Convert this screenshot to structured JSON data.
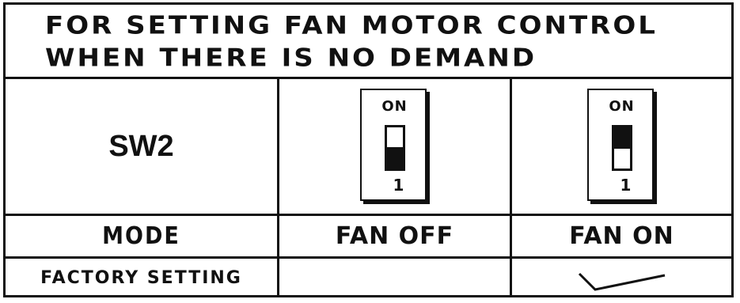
{
  "title": {
    "line1": "FOR SETTING FAN MOTOR CONTROL",
    "line2": "WHEN THERE IS NO DEMAND"
  },
  "table": {
    "switch_label": "SW2",
    "dip_switch_text": {
      "on_label": "ON",
      "position_number": "1"
    },
    "columns": [
      {
        "switch_state": "down",
        "mode": "FAN OFF",
        "factory_setting": false
      },
      {
        "switch_state": "up",
        "mode": "FAN ON",
        "factory_setting": true
      }
    ],
    "mode_label": "MODE",
    "factory_setting_label": "FACTORY SETTING"
  },
  "icons": {
    "factory_check": "checkmark-icon",
    "dip_switch": "dip-switch-icon"
  },
  "colors": {
    "ink": "#111111",
    "paper": "#ffffff"
  }
}
